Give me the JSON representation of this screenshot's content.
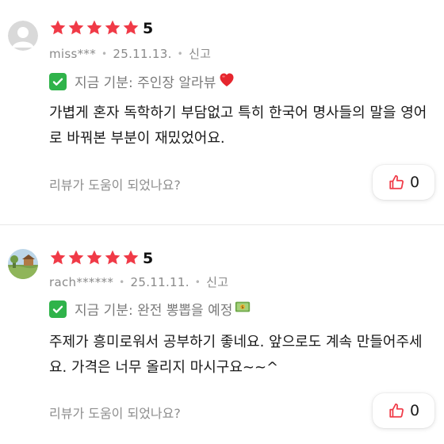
{
  "colors": {
    "star": "#f03a47",
    "thumb": "#f03a47",
    "check": "#2fb34a"
  },
  "reviews": [
    {
      "rating": "5",
      "stars": 5,
      "avatar_icon": "default-user-avatar",
      "username": "miss***",
      "date": "25.11.13.",
      "report_label": "신고",
      "tag_text": "지금 기분: 주인장 알라뷰",
      "tag_emoji": "heart-emoji",
      "body": "가볍게 혼자 독학하기 부담없고 특히 한국어 명사들의 말을 영어로 바꿔본 부분이 재밌었어요.",
      "helpful_prompt": "리뷰가 도움이 되었나요?",
      "like_count": "0"
    },
    {
      "rating": "5",
      "stars": 5,
      "avatar_icon": "landscape-photo-avatar",
      "username": "rach******",
      "date": "25.11.11.",
      "report_label": "신고",
      "tag_text": "지금 기분: 완전 뽕뽑을 예정",
      "tag_emoji": "money-bag-emoji",
      "body": "주제가 흥미로워서 공부하기 좋네요. 앞으로도 계속 만들어주세요. 가격은 너무 올리지 마시구요~~^",
      "helpful_prompt": "리뷰가 도움이 되었나요?",
      "like_count": "0"
    }
  ]
}
